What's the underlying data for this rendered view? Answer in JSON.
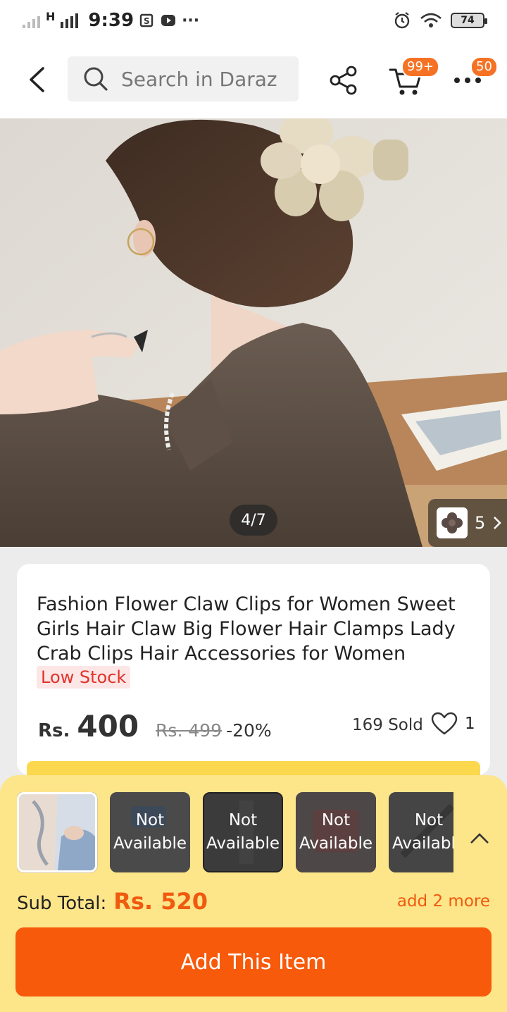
{
  "status_bar": {
    "network": "H",
    "time": "9:39",
    "battery": "74"
  },
  "header": {
    "search_placeholder": "Search in Daraz",
    "cart_badge": "99+",
    "more_badge": "50"
  },
  "gallery": {
    "counter": "4/7",
    "variant_count": "5"
  },
  "product": {
    "title": "Fashion Flower Claw Clips for Women Sweet Girls Hair Claw Big Flower Hair Clamps Lady Crab Clips Hair Accessories for Women",
    "stock_label": "Low Stock",
    "currency": "Rs.",
    "price": "400",
    "original_price": "Rs. 499",
    "discount": "-20%",
    "sold": "169 Sold",
    "likes": "1"
  },
  "bundle": {
    "items": [
      {
        "status": ""
      },
      {
        "status": "Not Available"
      },
      {
        "status": "Not Available"
      },
      {
        "status": "Not Available"
      },
      {
        "status": "Not Available"
      }
    ],
    "subtotal_label": "Sub Total:",
    "subtotal_value": "Rs. 520",
    "add_more": "add 2 more",
    "add_button": "Add This Item"
  },
  "colors": {
    "accent": "#f75a0a",
    "sheet": "#fde58a",
    "low_stock": "#e0332a"
  }
}
